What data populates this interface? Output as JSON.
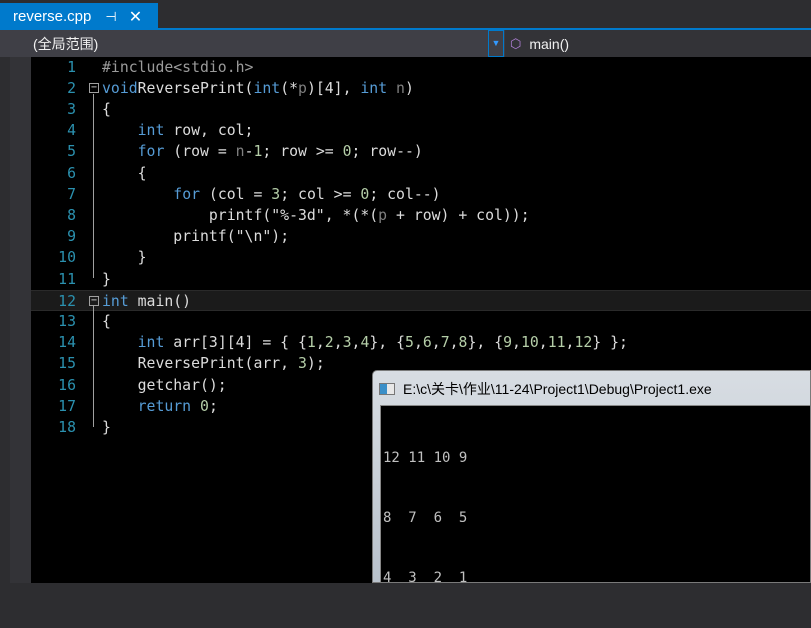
{
  "tab": {
    "filename": "reverse.cpp",
    "pin_icon": "pin-icon",
    "close_icon": "close-icon",
    "pin": "⊣",
    "close": "✕"
  },
  "navbar": {
    "scope": "(全局范围)",
    "member": "main()",
    "member_icon": "cube-icon"
  },
  "code": [
    [
      [
        "pre",
        "#include<stdio.h>"
      ]
    ],
    [
      [
        "kw",
        "void"
      ],
      [
        "",
        "ReversePrint("
      ],
      [
        "kw",
        "int"
      ],
      [
        "",
        "(*"
      ],
      [
        "param",
        "p"
      ],
      [
        "",
        ")[4], "
      ],
      [
        "kw",
        "int"
      ],
      [
        "",
        ""
      ],
      [
        "param",
        " n"
      ],
      [
        "",
        ")"
      ]
    ],
    [
      [
        "",
        "{"
      ]
    ],
    [
      [
        "",
        "    "
      ],
      [
        "kw",
        "int"
      ],
      [
        "",
        " row, col;"
      ]
    ],
    [
      [
        "",
        "    "
      ],
      [
        "kw",
        "for"
      ],
      [
        "",
        " (row = "
      ],
      [
        "param",
        "n"
      ],
      [
        "",
        "-"
      ],
      [
        "num",
        "1"
      ],
      [
        "",
        "; row >= "
      ],
      [
        "num",
        "0"
      ],
      [
        "",
        "; row--)"
      ]
    ],
    [
      [
        "",
        "    {"
      ]
    ],
    [
      [
        "",
        "        "
      ],
      [
        "kw",
        "for"
      ],
      [
        "",
        " (col = "
      ],
      [
        "num",
        "3"
      ],
      [
        "",
        "; col >= "
      ],
      [
        "num",
        "0"
      ],
      [
        "",
        "; col--)"
      ]
    ],
    [
      [
        "",
        "            printf("
      ],
      [
        "str",
        "\"%-3d\""
      ],
      [
        "",
        ", *(*("
      ],
      [
        "param",
        "p"
      ],
      [
        "",
        " + row) + col));"
      ]
    ],
    [
      [
        "",
        "        printf("
      ],
      [
        "str",
        "\"\\n\""
      ],
      [
        "",
        ");"
      ]
    ],
    [
      [
        "",
        "    }"
      ]
    ],
    [
      [
        "",
        "}"
      ]
    ],
    [
      [
        "kw",
        "int"
      ],
      [
        "",
        " main()"
      ]
    ],
    [
      [
        "",
        "{"
      ]
    ],
    [
      [
        "",
        "    "
      ],
      [
        "kw",
        "int"
      ],
      [
        "",
        " arr[3][4] = { {"
      ],
      [
        "num",
        "1"
      ],
      [
        "",
        ","
      ],
      [
        "num",
        "2"
      ],
      [
        "",
        ","
      ],
      [
        "num",
        "3"
      ],
      [
        "",
        ","
      ],
      [
        "num",
        "4"
      ],
      [
        "",
        "}, {"
      ],
      [
        "num",
        "5"
      ],
      [
        "",
        ","
      ],
      [
        "num",
        "6"
      ],
      [
        "",
        ","
      ],
      [
        "num",
        "7"
      ],
      [
        "",
        ","
      ],
      [
        "num",
        "8"
      ],
      [
        "",
        "}, {"
      ],
      [
        "num",
        "9"
      ],
      [
        "",
        ","
      ],
      [
        "num",
        "10"
      ],
      [
        "",
        ","
      ],
      [
        "num",
        "11"
      ],
      [
        "",
        ","
      ],
      [
        "num",
        "12"
      ],
      [
        "",
        "} };"
      ]
    ],
    [
      [
        "",
        "    ReversePrint(arr, "
      ],
      [
        "num",
        "3"
      ],
      [
        "",
        ");"
      ]
    ],
    [
      [
        "",
        "    getchar();"
      ]
    ],
    [
      [
        "",
        "    "
      ],
      [
        "kw",
        "return"
      ],
      [
        "",
        " "
      ],
      [
        "num",
        "0"
      ],
      [
        "",
        ";"
      ]
    ],
    [
      [
        "",
        "}"
      ]
    ]
  ],
  "current_line": 12,
  "fold_lines": [
    2,
    12
  ],
  "console": {
    "title": "E:\\c\\关卡\\作业\\11-24\\Project1\\Debug\\Project1.exe",
    "output": [
      "12 11 10 9",
      "8  7  6  5",
      "4  3  2  1"
    ]
  }
}
